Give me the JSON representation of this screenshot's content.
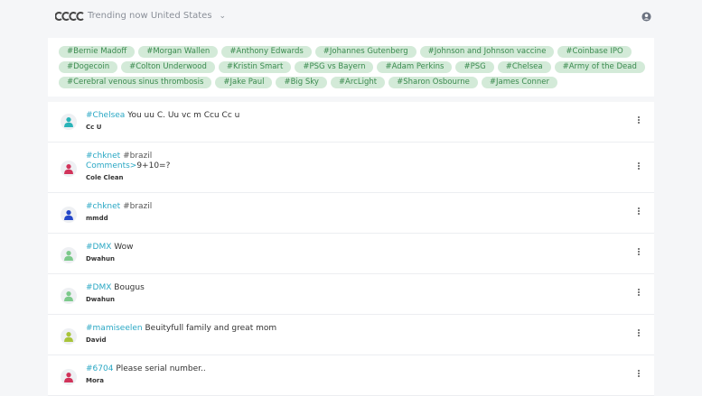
{
  "header": {
    "trending_label": "Trending now United States",
    "logo_text": "CCCC"
  },
  "tags": [
    "#Bernie Madoff",
    "#Morgan Wallen",
    "#Anthony Edwards",
    "#Johannes Gutenberg",
    "#Johnson and Johnson vaccine",
    "#Coinbase IPO",
    "#Dogecoin",
    "#Colton Underwood",
    "#Kristin Smart",
    "#PSG vs Bayern",
    "#Adam Perkins",
    "#PSG",
    "#Chelsea",
    "#Army of the Dead",
    "#Cerebral venous sinus thrombosis",
    "#Jake Paul",
    "#Big Sky",
    "#ArcLight",
    "#Sharon Osbourne",
    "#James Conner"
  ],
  "posts": [
    {
      "tag": "#Chelsea",
      "tag2": "",
      "text": "You uu C. Uu vc m Ccu Cc u",
      "line2_tag": "",
      "line2_text": "",
      "author": "Cc U",
      "avatar_color": "#29b3b8"
    },
    {
      "tag": "#chknet",
      "tag2": "#brazil",
      "text": "",
      "line2_tag": "Comments>",
      "line2_text": "9+10=?",
      "author": "Cole Clean",
      "avatar_color": "#d1335a"
    },
    {
      "tag": "#chknet",
      "tag2": "#brazil",
      "text": "",
      "line2_tag": "",
      "line2_text": "",
      "author": "mmdd",
      "avatar_color": "#2447c9"
    },
    {
      "tag": "#DMX",
      "tag2": "",
      "text": "Wow",
      "line2_tag": "",
      "line2_text": "",
      "author": "Dwahun",
      "avatar_color": "#7cc98b"
    },
    {
      "tag": "#DMX",
      "tag2": "",
      "text": "Bougus",
      "line2_tag": "",
      "line2_text": "",
      "author": "Dwahun",
      "avatar_color": "#7cc98b"
    },
    {
      "tag": "#mamiseelen",
      "tag2": "",
      "text": "Beuityfull family and great mom",
      "line2_tag": "",
      "line2_text": "",
      "author": "David",
      "avatar_color": "#a8c43a"
    },
    {
      "tag": "#6704",
      "tag2": "",
      "text": "Please serial number..",
      "line2_tag": "",
      "line2_text": "",
      "author": "Mora",
      "avatar_color": "#d1335a"
    }
  ]
}
